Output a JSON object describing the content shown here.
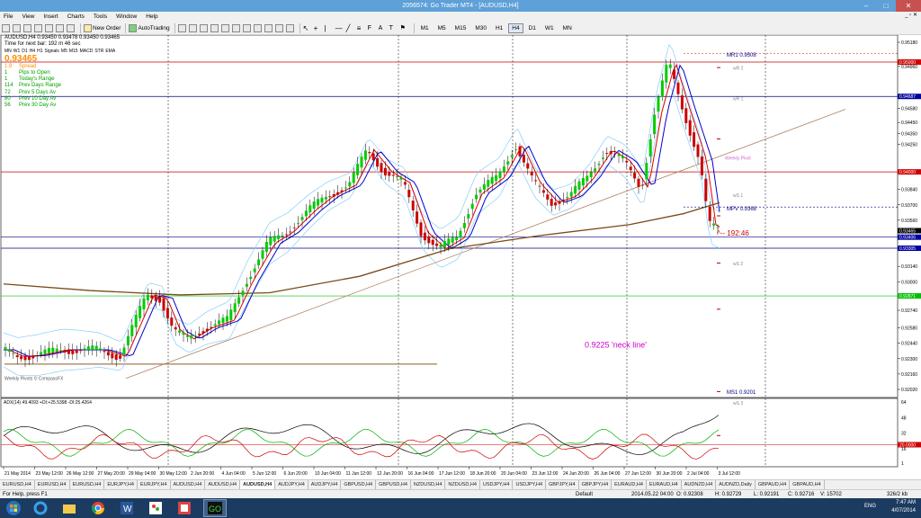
{
  "window": {
    "title": "2056574: Go Trader MT4 - [AUDUSD,H4]"
  },
  "menu": [
    "File",
    "View",
    "Insert",
    "Charts",
    "Tools",
    "Window",
    "Help"
  ],
  "toolbar": {
    "new_order": "New Order",
    "autotrading": "AutoTrading",
    "timeframes": [
      "M1",
      "M5",
      "M15",
      "M30",
      "H1",
      "H4",
      "D1",
      "W1",
      "MN"
    ],
    "active_timeframe": "H4"
  },
  "chart": {
    "header": "AUDUSD,H4  0.93450 0.93478 0.93450 0.93465",
    "timer_line": "Time for next bar: 192 m 46 sec",
    "indicator_legend": [
      "MN",
      "W1",
      "D1",
      "H4",
      "H1",
      "Signals",
      "M5",
      "M15",
      "MACD",
      "STR",
      "EMA"
    ],
    "price": "0.93465",
    "info_rows": [
      {
        "value": "1.9",
        "label": "Spread",
        "color": "#ff8c00"
      },
      {
        "value": "1",
        "label": "Pips to Open",
        "color": "#00a000"
      },
      {
        "value": "1",
        "label": "Today's Range",
        "color": "#00a000"
      },
      {
        "value": "114",
        "label": "Prev Days Range",
        "color": "#00a000"
      },
      {
        "value": "72",
        "label": "Prev 5 Days Av",
        "color": "#00a000"
      },
      {
        "value": "80",
        "label": "Prev 10 Day Av",
        "color": "#00a000"
      },
      {
        "value": "56",
        "label": "Prev 30 Day Av",
        "color": "#00a000"
      }
    ],
    "annotations": {
      "neck_line": "0.9225 'neck line'",
      "countdown": "^-- 192:46",
      "weekly_pivots": "Weekly Pivots  © CompassFX",
      "mr1": "MR1  0.9508",
      "mpv": "MPV  0.9368",
      "ms1": "MS1  0.9201",
      "weekly_pivot": "Weekly Pivot",
      "wr2": "wR 2",
      "wr1": "wR 1",
      "ws1": "wS 1",
      "ws2": "wS 2",
      "ws3": "wS 3"
    },
    "price_ticks": [
      "0.95180",
      "0.95000",
      "0.94960",
      "0.94687",
      "0.94580",
      "0.94450",
      "0.94350",
      "0.94250",
      "0.94000",
      "0.93840",
      "0.93700",
      "0.93560",
      "0.93465",
      "0.93406",
      "0.93305",
      "0.93140",
      "0.93000",
      "0.92871",
      "0.92740",
      "0.92580",
      "0.92440",
      "0.92300",
      "0.92160",
      "0.92020"
    ],
    "adx": {
      "label": "ADX(14) 49.4093  +DI:+25.5398  -DI:25.4264",
      "ticks": [
        "64",
        "48",
        "32",
        "20.0000",
        "16",
        "1"
      ]
    },
    "date_ticks": [
      "21 May 2014",
      "23 May 12:00",
      "26 May 12:00",
      "27 May 20:00",
      "29 May 04:00",
      "30 May 12:00",
      "2 Jun 20:00",
      "4 Jun 04:00",
      "5 Jun 12:00",
      "6 Jun 20:00",
      "10 Jun 04:00",
      "11 Jun 12:00",
      "12 Jun 20:00",
      "16 Jun 04:00",
      "17 Jun 12:00",
      "18 Jun 20:00",
      "20 Jun 04:00",
      "23 Jun 12:00",
      "24 Jun 20:00",
      "26 Jun 04:00",
      "27 Jun 12:00",
      "30 Jun 20:00",
      "2 Jul 04:00",
      "3 Jul 12:00"
    ]
  },
  "tabs": [
    "EURUSD,H4",
    "EURUSD,H4",
    "EURUSD,H4",
    "EURJPY,H4",
    "EURJPY,H4",
    "AUDUSD,H4",
    "AUDUSD,H4",
    "AUDUSD,H4",
    "AUDJPY,H4",
    "AUDJPY,H4",
    "GBPUSD,H4",
    "GBPUSD,H4",
    "NZDUSD,H4",
    "NZDUSD,H4",
    "USDJPY,H4",
    "USDJPY,H4",
    "GBPJPY,H4",
    "GBPJPY,H4",
    "EURAUD,H4",
    "EURAUD,H4",
    "AUDNZD,H4",
    "AUDNZD,Daily",
    "GBPAUD,H4",
    "GBPAUD,H4"
  ],
  "active_tab": 7,
  "status": {
    "help": "For Help, press F1",
    "profile": "Default",
    "time": "2014.05.22 04:00",
    "open": "O: 0.92308",
    "high": "H: 0.92729",
    "low": "L: 0.92191",
    "close": "C: 0.92716",
    "volume": "V: 15702",
    "traffic": "326/2 kb"
  },
  "taskbar": {
    "time": "7:47 AM",
    "date": "4/07/2014",
    "lang": "ENG"
  }
}
